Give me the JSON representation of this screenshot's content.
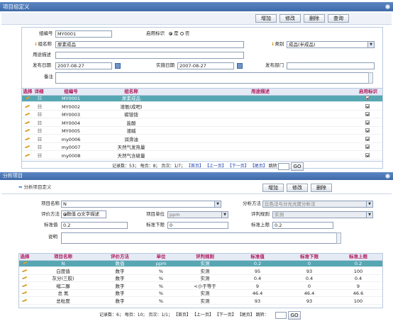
{
  "window": {
    "title": "项目组定义"
  },
  "top_toolbar": {
    "add": "增加",
    "edit": "修改",
    "delete": "删除",
    "query": "查询"
  },
  "form": {
    "code_label": "组编号",
    "code_value": "MY0001",
    "enable_label": "启用标识",
    "enable_yes": "是",
    "enable_no": "否",
    "name_label": "组名称",
    "name_value": "尿素成品",
    "category_label": "类别",
    "category_value": "成品(半成品)",
    "usage_label": "用途描述",
    "usage_value": "",
    "publish_date_label": "发布日期",
    "publish_date_value": "2007-08-27",
    "impl_date_label": "实施日期",
    "impl_date_value": "2007-08-27",
    "publish_dept_label": "发布部门",
    "publish_dept_value": "",
    "remark_label": "备注",
    "remark_value": ""
  },
  "group_table": {
    "headers": [
      "选择",
      "详细",
      "组编号",
      "组名称",
      "用途描述",
      "启用标识"
    ],
    "rows": [
      {
        "code": "MY0001",
        "name": "尿素成品",
        "desc": "",
        "enabled": true,
        "selected": true
      },
      {
        "code": "MY0002",
        "name": "液氨(成吧)",
        "desc": "",
        "enabled": true,
        "selected": false
      },
      {
        "code": "MY0003",
        "name": "碳铵铵",
        "desc": "",
        "enabled": true,
        "selected": false
      },
      {
        "code": "MY0004",
        "name": "盐酸",
        "desc": "",
        "enabled": true,
        "selected": false
      },
      {
        "code": "MY0005",
        "name": "液碱",
        "desc": "",
        "enabled": true,
        "selected": false
      },
      {
        "code": "my0006",
        "name": "润滑油",
        "desc": "",
        "enabled": true,
        "selected": false
      },
      {
        "code": "my0007",
        "name": "天然气发热量",
        "desc": "",
        "enabled": true,
        "selected": false
      },
      {
        "code": "my0008",
        "name": "天然气含硫量",
        "desc": "",
        "enabled": true,
        "selected": false
      }
    ],
    "pager": {
      "total": "记录数：53；",
      "per_page": "每页：8；",
      "page": "页次：1/7；",
      "first": "【首页】",
      "prev": "【上一页】",
      "next": "【下一页】",
      "last": "【尾页】",
      "jump": "跳转：",
      "go": "GO"
    }
  },
  "analysis": {
    "section_title": "分析项目",
    "sub_title": "分析项目定义",
    "toolbar": {
      "add": "增加",
      "edit": "修改",
      "delete": "删除"
    },
    "item_name_label": "项目名称",
    "item_name_value": "N",
    "method_label": "分析方法",
    "method_value": "比色法与分光光度分析法",
    "eval_label": "评价方法",
    "eval_num": "数值",
    "eval_text": "文字描述",
    "unit_label": "项目单位",
    "unit_value": "ppm",
    "rule_label": "评判规则",
    "rule_value": "实测",
    "std_label": "标准值",
    "std_value": "0.2",
    "lower_label": "标准下限",
    "lower_value": "0",
    "upper_label": "标准上限",
    "upper_value": "0.2",
    "desc_label": "说明",
    "desc_value": ""
  },
  "item_table": {
    "headers": [
      "选择",
      "项目名称",
      "评价方法",
      "单位",
      "评判规则",
      "标准值",
      "标准下限",
      "标准上限"
    ],
    "rows": [
      {
        "name": "N",
        "eval": "数值",
        "unit": "ppm",
        "rule": "实测",
        "std": "0.2",
        "lower": "0",
        "upper": "0.2",
        "selected": true
      },
      {
        "name": "白度值",
        "eval": "数字",
        "unit": "%",
        "rule": "实测",
        "std": "95",
        "lower": "93",
        "upper": "100",
        "selected": false
      },
      {
        "name": "灰分(三胶)",
        "eval": "数字",
        "unit": "%",
        "rule": "实测",
        "std": "0.4",
        "lower": "0.4",
        "upper": "0.4",
        "selected": false
      },
      {
        "name": "缩二脲",
        "eval": "数字",
        "unit": "%",
        "rule": "<小于等于",
        "std": "9",
        "lower": "0",
        "upper": "9",
        "selected": false
      },
      {
        "name": "总  氮",
        "eval": "数字",
        "unit": "%",
        "rule": "实测",
        "std": "46.4",
        "lower": "46.4",
        "upper": "46.6",
        "selected": false
      },
      {
        "name": "总粒度",
        "eval": "数字",
        "unit": "%",
        "rule": "实测",
        "std": "93",
        "lower": "93",
        "upper": "100",
        "selected": false
      }
    ],
    "pager": {
      "total": "记录数：6；",
      "per_page": "每页：10；",
      "page": "页次：1/1；",
      "first": "【首页】",
      "prev": "【上一页】",
      "next": "【下一页】",
      "last": "【尾页】",
      "jump": "跳转：",
      "go": "GO"
    }
  },
  "colors": {
    "header_bar": "#4a78b8",
    "selected_row": "#57a7b3",
    "header_text": "#b0155a",
    "link": "#1c3fa8"
  }
}
